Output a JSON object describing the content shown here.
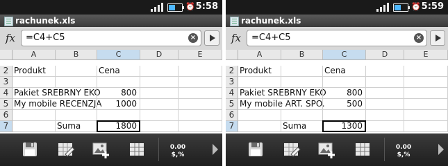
{
  "panels": [
    {
      "status_time": "5:58",
      "filename": "rachunek.xls",
      "formula": "=C4+C5",
      "columns": [
        "A",
        "B",
        "C",
        "D",
        "E"
      ],
      "selected_column": "C",
      "rows": [
        "2",
        "3",
        "4",
        "5",
        "6",
        "7"
      ],
      "selected_row": "7",
      "cells": {
        "a2": "Produkt",
        "c2": "Cena",
        "a4": "Pakiet SREBRNY EKO",
        "c4": "800",
        "a5": "My mobile RECENZJA",
        "c5": "1000",
        "b7": "Suma",
        "c7": "1800"
      },
      "toolbar": {
        "number_format_line1": "0.00",
        "number_format_line2": "$,%"
      }
    },
    {
      "status_time": "5:59",
      "filename": "rachunek.xls",
      "formula": "=C4+C5",
      "columns": [
        "A",
        "B",
        "C",
        "D",
        "E"
      ],
      "selected_column": "C",
      "rows": [
        "2",
        "3",
        "4",
        "5",
        "6",
        "7"
      ],
      "selected_row": "7",
      "cells": {
        "a2": "Produkt",
        "c2": "Cena",
        "a4": "Pakiet SREBRNY EKO",
        "c4": "800",
        "a5": "My mobile ART. SPO.",
        "c5": "500",
        "b7": "Suma",
        "c7": "1300"
      },
      "toolbar": {
        "number_format_line1": "0.00",
        "number_format_line2": "$,%"
      }
    }
  ],
  "icons": {
    "fx": "fx-icon",
    "clear": "clear-icon",
    "go": "enter-arrow-icon",
    "save": "save-icon",
    "edit": "edit-sheet-icon",
    "insert": "insert-image-icon",
    "grid": "grid-icon",
    "more": "more-arrow-icon",
    "battery": "battery-icon",
    "signal": "signal-icon",
    "alarm": "alarm-icon",
    "file": "xls-file-icon"
  },
  "colors": {
    "selection_header": "#c6dcef",
    "statusbar": "#1a1a1a",
    "battery_fill": "#4fb8ff"
  }
}
